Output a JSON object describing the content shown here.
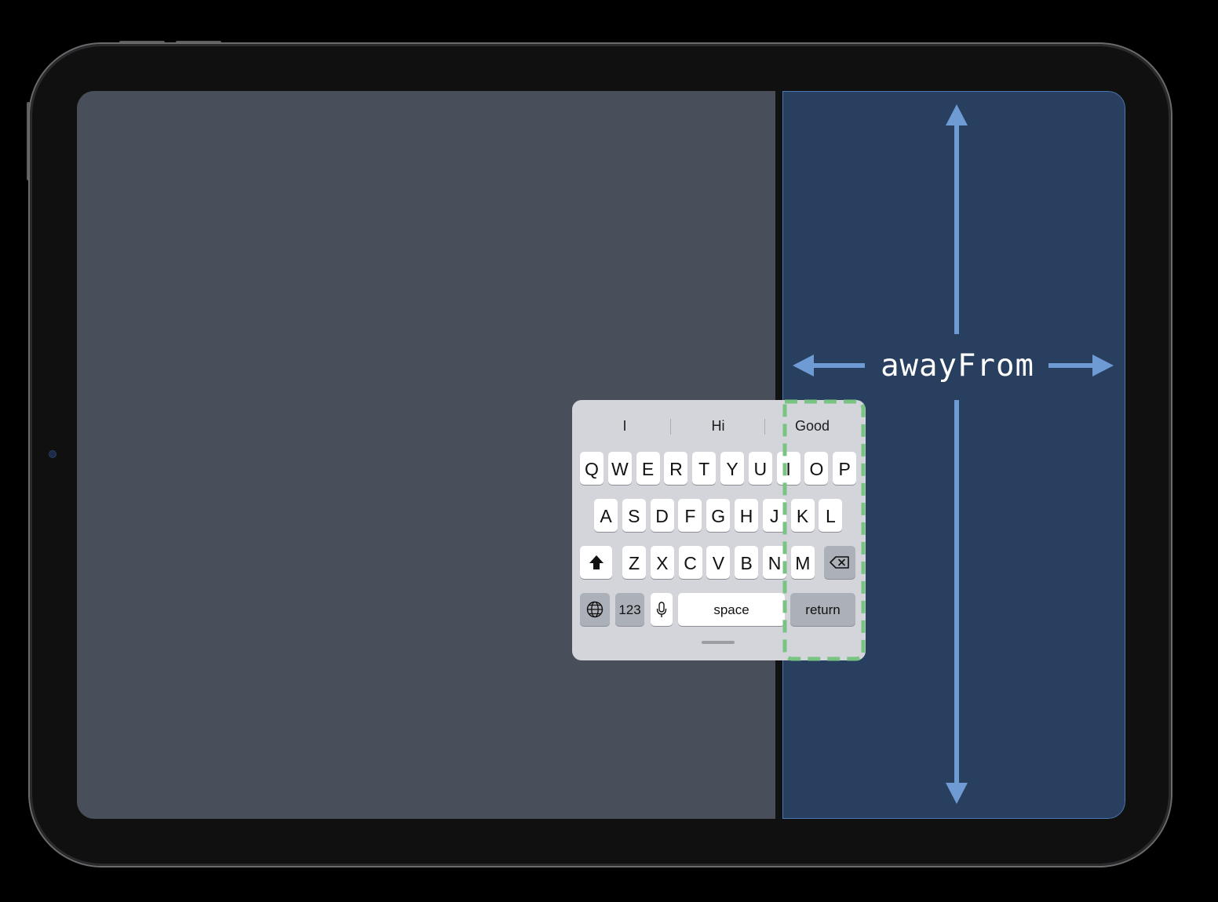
{
  "annotation": {
    "label": "awayFrom",
    "arrow_color": "#6f9bd4",
    "highlight_color": "#7ac483"
  },
  "colors": {
    "left_pane": "#484f5a",
    "right_pane": "#283f5f",
    "keyboard_bg": "#d3d5db"
  },
  "keyboard": {
    "suggestions": [
      "I",
      "Hi",
      "Good"
    ],
    "row1": [
      "Q",
      "W",
      "E",
      "R",
      "T",
      "Y",
      "U",
      "I",
      "O",
      "P"
    ],
    "row2": [
      "A",
      "S",
      "D",
      "F",
      "G",
      "H",
      "J",
      "K",
      "L"
    ],
    "row3": [
      "Z",
      "X",
      "C",
      "V",
      "B",
      "N",
      "M"
    ],
    "numbers_label": "123",
    "space_label": "space",
    "return_label": "return",
    "icons": {
      "shift": "shift-icon",
      "delete": "delete-icon",
      "globe": "globe-icon",
      "mic": "microphone-icon"
    }
  }
}
